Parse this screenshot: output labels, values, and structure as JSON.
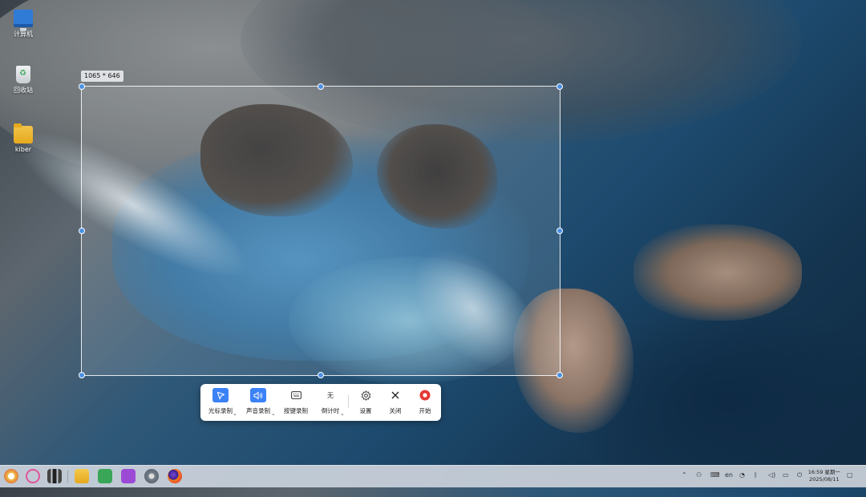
{
  "desktop": {
    "icons": [
      {
        "label": "计算机",
        "icon": "computer-icon"
      },
      {
        "label": "回收站",
        "icon": "trash-icon"
      },
      {
        "label": "kiber",
        "icon": "folder-icon"
      }
    ]
  },
  "selection": {
    "dimensions_label": "1065 * 646"
  },
  "toolbar": {
    "items": [
      {
        "label": "光标录制",
        "icon": "cursor-icon",
        "active": true,
        "has_dropdown": true
      },
      {
        "label": "声音录制",
        "icon": "speaker-icon",
        "active": true,
        "has_dropdown": true
      },
      {
        "label": "按键录制",
        "icon": "keyboard-icon",
        "active": false,
        "has_dropdown": false
      },
      {
        "label": "倒计时",
        "icon": "countdown-value",
        "value": "无",
        "has_dropdown": true
      },
      {
        "label": "设置",
        "icon": "gear-icon"
      },
      {
        "label": "关闭",
        "icon": "close-icon"
      },
      {
        "label": "开始",
        "icon": "record-icon"
      }
    ],
    "accent_color": "#3b82f6",
    "record_color": "#e53935"
  },
  "taskbar": {
    "apps": [
      {
        "name": "launcher-icon"
      },
      {
        "name": "search-icon"
      },
      {
        "name": "multitask-icon"
      },
      {
        "name": "file-manager-icon"
      },
      {
        "name": "mail-icon"
      },
      {
        "name": "software-store-icon"
      },
      {
        "name": "settings-icon"
      },
      {
        "name": "firefox-icon"
      }
    ],
    "tray": {
      "input_method": "en",
      "time": "16:59 星期一",
      "date": "2025/08/11"
    }
  }
}
